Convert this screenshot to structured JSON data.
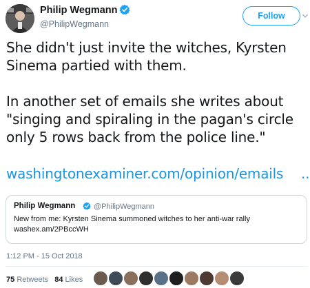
{
  "author": {
    "name": "Philip Wegmann",
    "handle": "@PhilipWegmann",
    "verified": true
  },
  "follow_label": "Follow",
  "tweet": {
    "paragraph1": "She didn't just invite the witches, Kyrsten Sinema partied with them.",
    "paragraph2": "In another set of emails she writes about \"singing and spiraling in the pagan's circle only 5 rows back from the police line.\"",
    "link": "washingtonexaminer.com/opinion/emails",
    "link_ellipsis": "..."
  },
  "quoted": {
    "name": "Philip Wegmann",
    "handle": "@PhilipWegmann",
    "text_line1": "New from me: Kyrsten Sinema summoned witches to her anti-war rally",
    "text_line2": "washex.am/2PBccWH"
  },
  "timestamp": "1:12 PM - 15 Oct 2018",
  "stats": {
    "retweets_count": "75",
    "retweets_label": "Retweets",
    "likes_count": "84",
    "likes_label": "Likes"
  },
  "colors": {
    "link_blue": "#1b95e0",
    "follow_blue": "#1da1f2",
    "muted": "#657786",
    "border": "#ccd6dd"
  },
  "icons": [
    "verified-badge-icon",
    "chevron-down-icon"
  ]
}
